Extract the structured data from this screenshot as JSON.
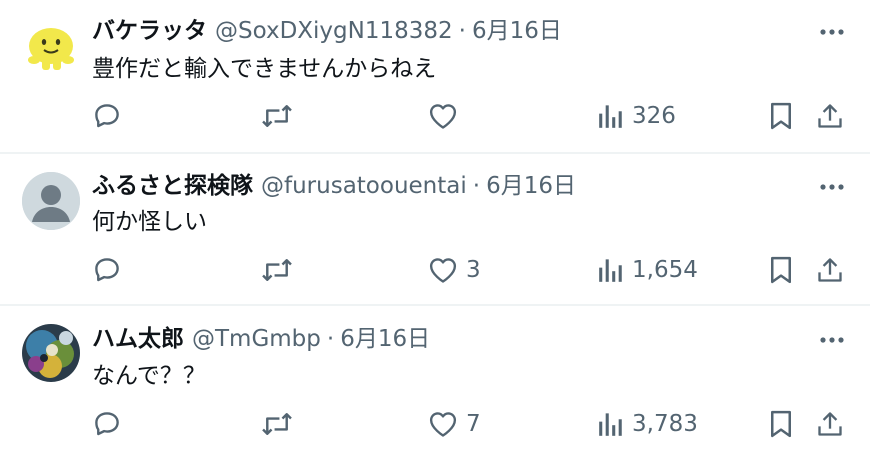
{
  "colors": {
    "text": "#0f1419",
    "secondary": "#536471",
    "divider": "#eff3f4"
  },
  "tweets": [
    {
      "display_name": "バケラッタ",
      "handle": "@SoxDXiygN118382",
      "separator": "·",
      "date": "6月16日",
      "text": "豊作だと輸入できませんからねえ",
      "avatar": "yellow-character-avatar",
      "likes": "",
      "views": "326"
    },
    {
      "display_name": "ふるさと探検隊",
      "handle": "@furusatoouentai",
      "separator": "·",
      "date": "6月16日",
      "text": "何か怪しい",
      "avatar": "default-person-avatar",
      "likes": "3",
      "views": "1,654"
    },
    {
      "display_name": "ハム太郎",
      "handle": "@TmGmbp",
      "separator": "·",
      "date": "6月16日",
      "text": "なんで？？",
      "avatar": "colorful-photo-avatar",
      "likes": "7",
      "views": "3,783"
    }
  ]
}
